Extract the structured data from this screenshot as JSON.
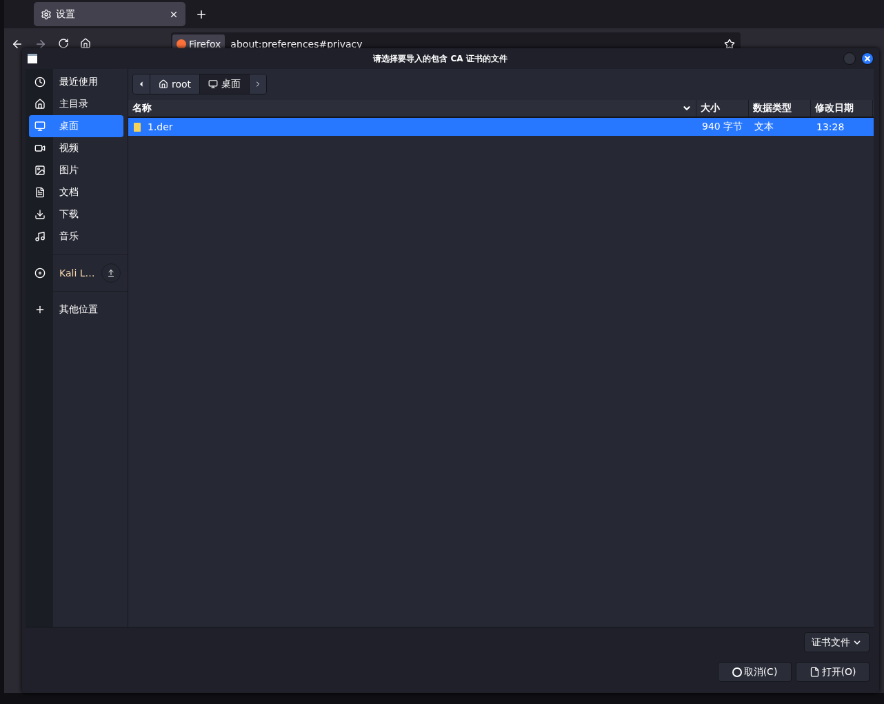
{
  "browser": {
    "tab": {
      "title": "设置",
      "selected": true
    },
    "identity": "Firefox",
    "url": "about:preferences#privacy"
  },
  "dialog": {
    "title": "请选择要导入的包含 CA 证书的文件",
    "places": [
      {
        "label": "最近使用",
        "kind": "recent",
        "selected": false
      },
      {
        "label": "主目录",
        "kind": "home",
        "selected": false
      },
      {
        "label": "桌面",
        "kind": "desktop",
        "selected": true
      },
      {
        "label": "视频",
        "kind": "video",
        "selected": false
      },
      {
        "label": "图片",
        "kind": "image",
        "selected": false
      },
      {
        "label": "文档",
        "kind": "document",
        "selected": false
      },
      {
        "label": "下载",
        "kind": "download",
        "selected": false
      },
      {
        "label": "音乐",
        "kind": "music",
        "selected": false
      }
    ],
    "devices": [
      {
        "label": "Kali L…",
        "kind": "disc",
        "selected": false
      }
    ],
    "other_locations": {
      "label": "其他位置",
      "kind": "plus",
      "selected": false
    },
    "path": [
      {
        "label": "root",
        "kind": "home",
        "selected": false
      },
      {
        "label": "桌面",
        "kind": "desktop",
        "selected": true
      }
    ],
    "columns": [
      {
        "label": "名称",
        "sorted": true
      },
      {
        "label": "大小",
        "sorted": false
      },
      {
        "label": "数据类型",
        "sorted": false
      },
      {
        "label": "修改日期",
        "sorted": false
      }
    ],
    "files": [
      {
        "name": "1.der",
        "size": "940 字节",
        "type": "文本",
        "modified": "13:28",
        "selected": true
      }
    ],
    "filter": "证书文件",
    "buttons": [
      {
        "label": "取消(C)",
        "kind": "cancel"
      },
      {
        "label": "打开(O)",
        "kind": "open"
      }
    ]
  }
}
